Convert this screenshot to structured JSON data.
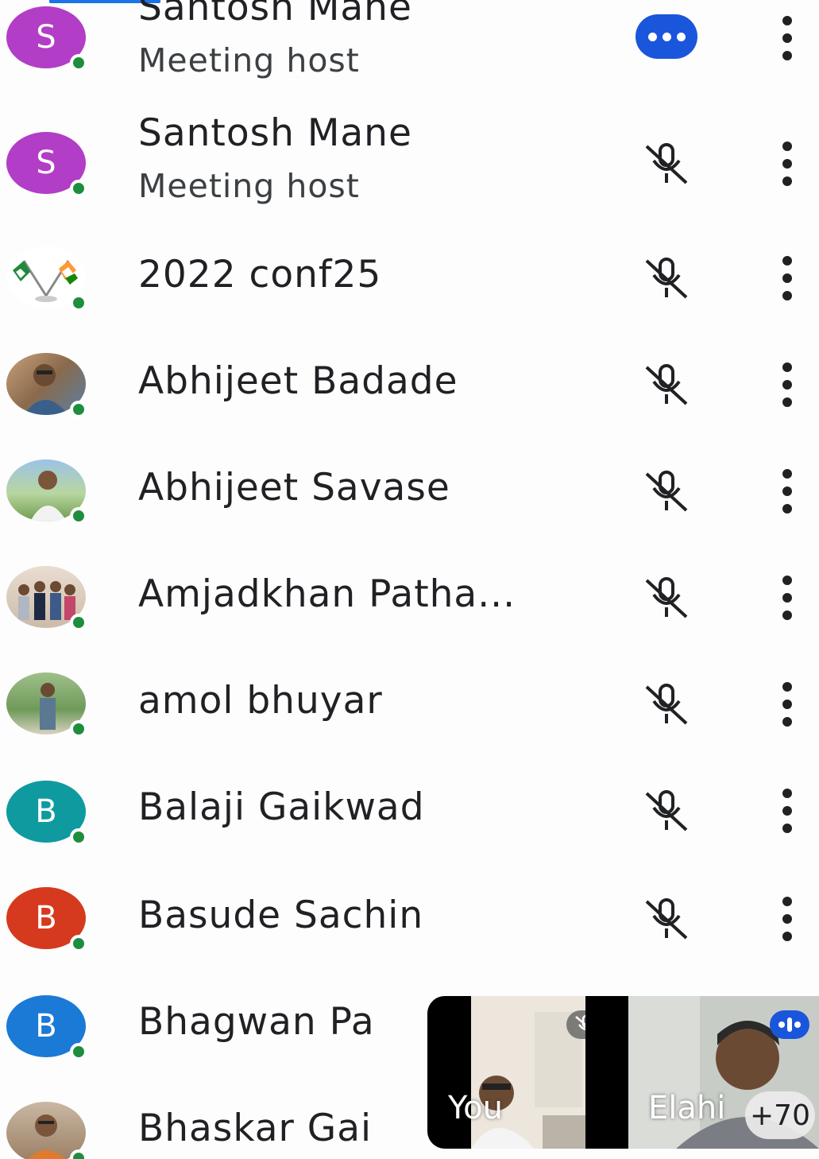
{
  "participants": [
    {
      "name": "Santosh Mane",
      "role": "Meeting host",
      "initial": "S",
      "avatar_color": "#b23dc6",
      "status": "speaking"
    },
    {
      "name": "Santosh Mane",
      "role": "Meeting host",
      "initial": "S",
      "avatar_color": "#b23dc6",
      "status": "muted"
    },
    {
      "name": "2022 conf25",
      "role": "",
      "initial": "",
      "avatar_color": "",
      "status": "muted"
    },
    {
      "name": "Abhijeet Badade",
      "role": "",
      "initial": "",
      "avatar_color": "",
      "status": "muted"
    },
    {
      "name": "Abhijeet Savase",
      "role": "",
      "initial": "",
      "avatar_color": "",
      "status": "muted"
    },
    {
      "name": "Amjadkhan Patha...",
      "role": "",
      "initial": "",
      "avatar_color": "",
      "status": "muted"
    },
    {
      "name": "amol bhuyar",
      "role": "",
      "initial": "",
      "avatar_color": "",
      "status": "muted"
    },
    {
      "name": "Balaji Gaikwad",
      "role": "",
      "initial": "B",
      "avatar_color": "#0f9aa0",
      "status": "muted"
    },
    {
      "name": "Basude Sachin",
      "role": "",
      "initial": "B",
      "avatar_color": "#d63a1e",
      "status": "muted"
    },
    {
      "name": "Bhagwan Pa",
      "role": "",
      "initial": "B",
      "avatar_color": "#1a7ad6",
      "status": ""
    },
    {
      "name": "Bhaskar Gai",
      "role": "",
      "initial": "",
      "avatar_color": "",
      "status": ""
    }
  ],
  "video_tiles": {
    "you_label": "You",
    "other_label": "Elahi",
    "more_count": "+70"
  },
  "icons": {
    "mic_off": "mic-off-icon",
    "more": "more-vert-icon",
    "speaking": "speaking-indicator-icon",
    "online": "online-dot"
  },
  "colors": {
    "online": "#1e8e3e",
    "speaking": "#1a56db",
    "accent": "#1a73e8"
  }
}
